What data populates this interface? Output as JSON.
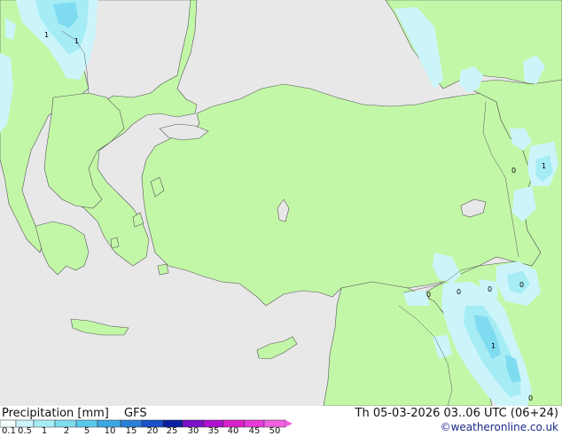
{
  "header": {
    "title": "Precipitation [mm]",
    "model": "GFS"
  },
  "valid_time": "Th 05-03-2026 03..06 UTC (06+24)",
  "copyright": "©weatheronline.co.uk",
  "legend": {
    "ticks": [
      "0.1",
      "0.5",
      "1",
      "2",
      "5",
      "10",
      "15",
      "20",
      "25",
      "30",
      "35",
      "40",
      "45",
      "50"
    ],
    "colors": [
      "#f5fffa",
      "#ccf5fb",
      "#a6ecf5",
      "#7fdcf0",
      "#5bc8ea",
      "#3aa6e0",
      "#2a80d8",
      "#1b50c8",
      "#0a1fa0",
      "#7a10c8",
      "#b010d0",
      "#d820c8",
      "#e83ad8",
      "#f060e0"
    ]
  },
  "map_labels": [
    "1",
    "1",
    "0",
    "1",
    "0",
    "0",
    "0",
    "0",
    "1",
    "0"
  ],
  "colors": {
    "land": "#c2f7a8",
    "sea": "#e8e8e8",
    "light_precip": "#ccf5fb",
    "mid_precip": "#a6ecf5",
    "heavy_precip": "#7fdcf0"
  }
}
